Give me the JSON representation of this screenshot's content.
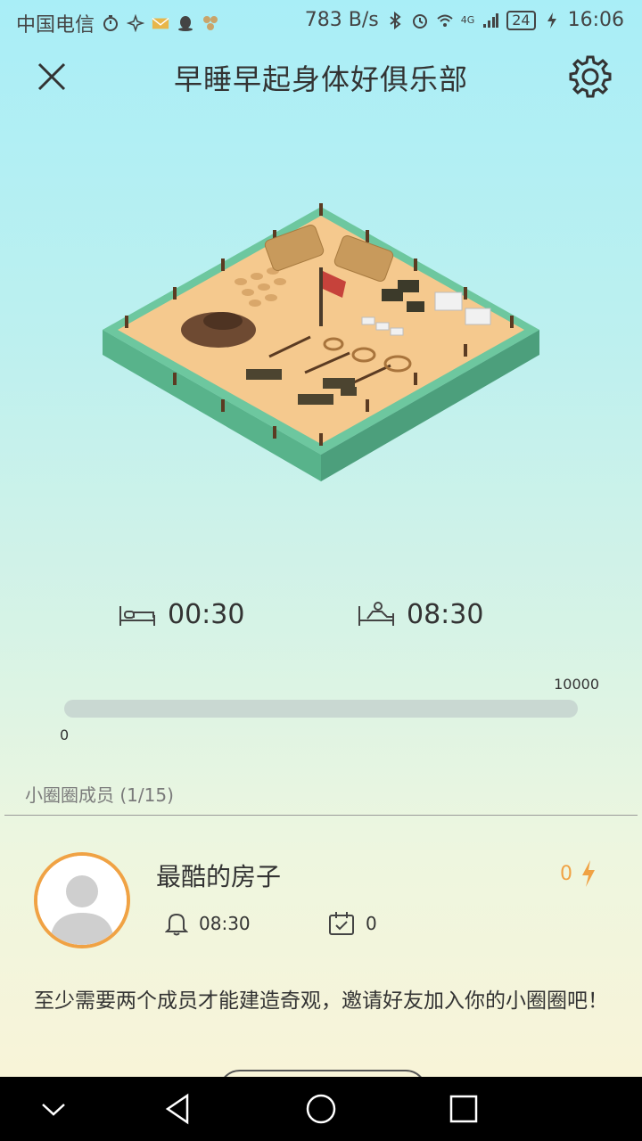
{
  "status_bar": {
    "carrier": "中国电信",
    "network_speed": "783 B/s",
    "network_type": "4G",
    "battery": "24",
    "time": "16:06"
  },
  "header": {
    "title": "早睡早起身体好俱乐部",
    "close_icon": "close-icon",
    "settings_icon": "gear-icon"
  },
  "sleep": {
    "bed_time": "00:30",
    "wake_time": "08:30"
  },
  "progress": {
    "max_label": "10000",
    "min_label": "0",
    "value": 0
  },
  "members": {
    "label": "小圈圈成员 (1/15)",
    "list": [
      {
        "name": "最酷的房子",
        "alarm": "08:30",
        "days": "0",
        "energy": "0"
      }
    ]
  },
  "invite": {
    "text": "至少需要两个成员才能建造奇观，邀请好友加入你的小圈圈吧！"
  },
  "colors": {
    "accent": "#f0a244",
    "text": "#333333",
    "muted": "#7a7a7a"
  }
}
